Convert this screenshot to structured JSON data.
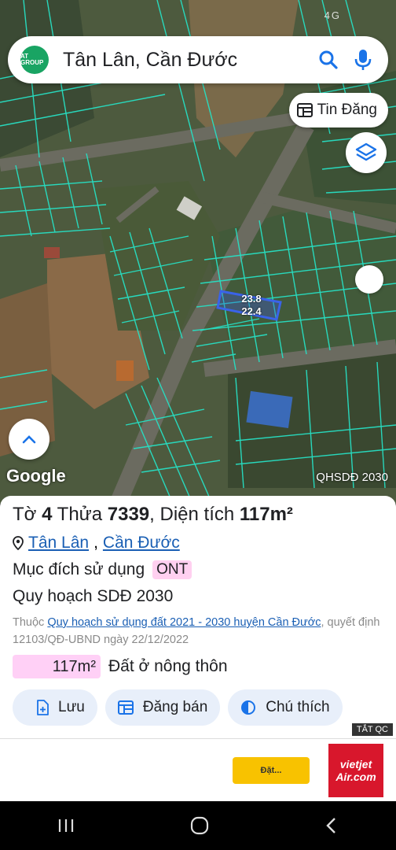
{
  "status": {
    "signal_text": "4G"
  },
  "search": {
    "query": "Tân Lân, Cần Đước",
    "logo_text": "AT GROUP"
  },
  "map": {
    "tin_dang_label": "Tin Đăng",
    "parcel_width": "23.8",
    "parcel_length": "22.4",
    "google_attribution": "Google",
    "layer_name": "QHSDĐ 2030"
  },
  "parcel": {
    "to_label": "Tờ",
    "to_value": "4",
    "thua_label": "Thửa",
    "thua_value": "7339",
    "dien_tich_label": ", Diện tích",
    "dien_tich_value": "117m²",
    "ward": "Tân Lân",
    "district": "Cần Đước",
    "muc_dich_label": "Mục đích sử dụng",
    "muc_dich_code": "ONT",
    "quy_hoach_title": "Quy hoạch SDĐ 2030",
    "thuoc_label": "Thuộc",
    "plan_link": "Quy hoạch sử dụng đất 2021 - 2030 huyện Cần Đước",
    "decision_text": ", quyết định 12103/QĐ-UBND ngày 22/12/2022",
    "area_value": "117m²",
    "area_type": "Đất ở nông thôn"
  },
  "actions": {
    "save": "Lưu",
    "post_sale": "Đăng bán",
    "legend": "Chú thích"
  },
  "ad": {
    "close_tag": "TẮT QC",
    "cta": "Đặt...",
    "brand_line1": "vietjet",
    "brand_line2": "Air.com"
  },
  "colors": {
    "parcel_line": "#27e0c4",
    "area_chip": "#ffd0f6",
    "link": "#1a5fb4",
    "chip_bg": "#e8effa"
  }
}
